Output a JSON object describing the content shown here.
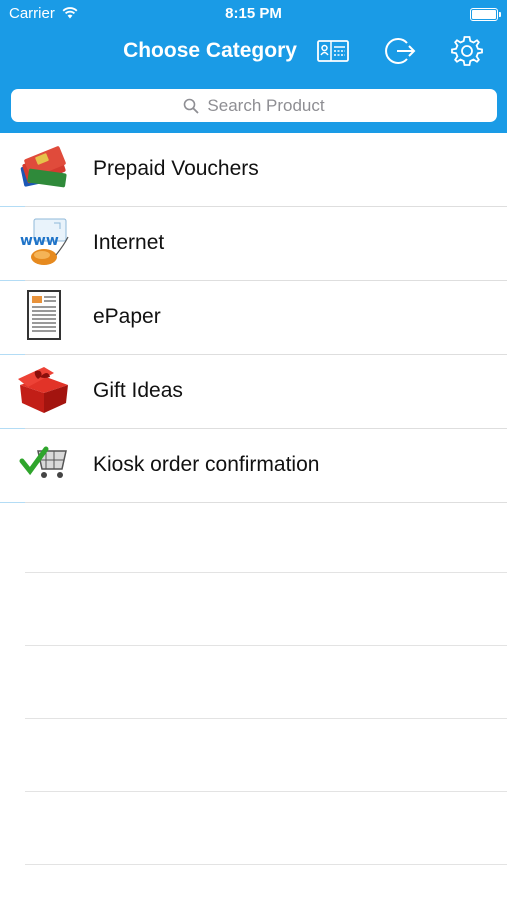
{
  "status_bar": {
    "carrier": "Carrier",
    "time": "8:15 PM"
  },
  "nav": {
    "title": "Choose Category",
    "icons": [
      "id-card-icon",
      "logout-icon",
      "gear-icon"
    ]
  },
  "search": {
    "placeholder": "Search Product"
  },
  "categories": [
    {
      "label": "Prepaid Vouchers",
      "icon": "sim-cards-icon"
    },
    {
      "label": "Internet",
      "icon": "www-mouse-icon"
    },
    {
      "label": "ePaper",
      "icon": "newspaper-icon"
    },
    {
      "label": "Gift Ideas",
      "icon": "gift-box-icon"
    },
    {
      "label": "Kiosk order confirmation",
      "icon": "cart-check-icon"
    }
  ],
  "colors": {
    "header": "#1a9be6",
    "separator_accent": "#b3dcf5"
  }
}
